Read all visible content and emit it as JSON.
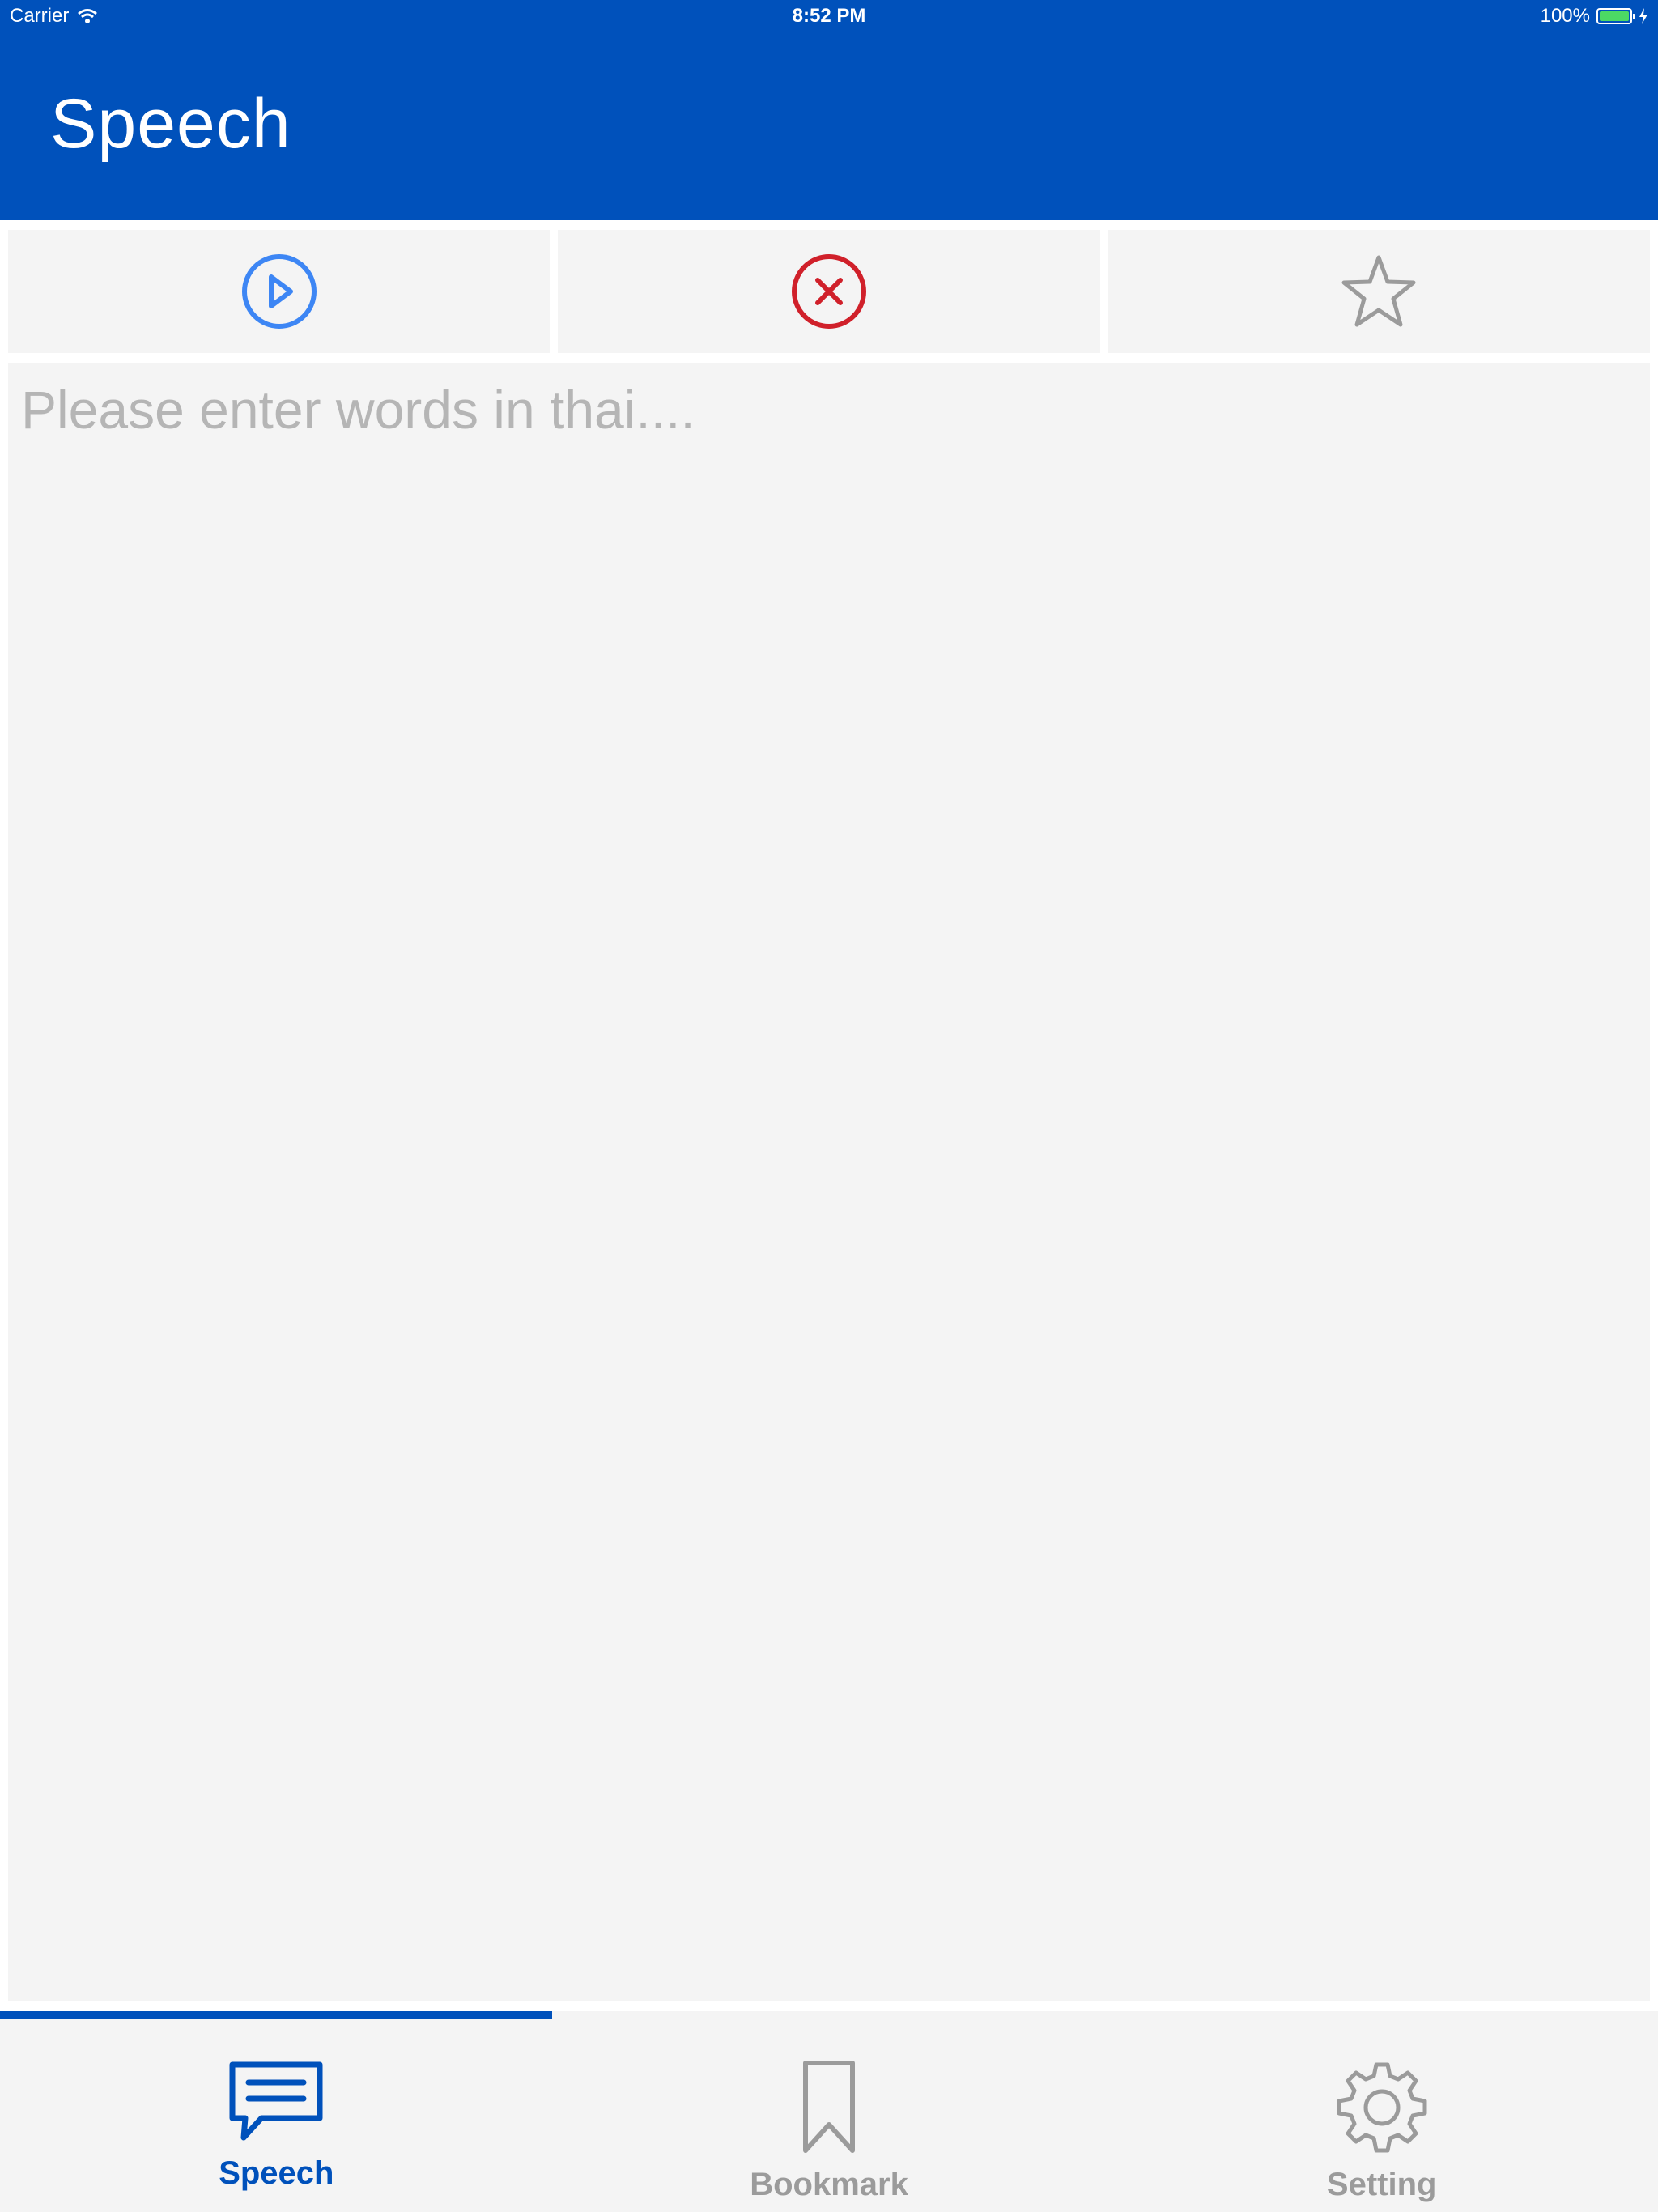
{
  "status_bar": {
    "carrier": "Carrier",
    "time": "8:52 PM",
    "battery": "100%",
    "battery_level": 1.0
  },
  "nav": {
    "title": "Speech"
  },
  "toolbar": {
    "play_icon": "play-circle-icon",
    "clear_icon": "close-circle-icon",
    "bookmark_icon": "star-outline-icon"
  },
  "editor": {
    "placeholder": "Please enter words in thai....",
    "value": ""
  },
  "tabs": [
    {
      "label": "Speech",
      "icon": "speech-bubble-icon",
      "active": true
    },
    {
      "label": "Bookmark",
      "icon": "bookmark-icon",
      "active": false
    },
    {
      "label": "Setting",
      "icon": "gear-icon",
      "active": false
    }
  ],
  "colors": {
    "primary": "#0051bb",
    "play": "#3d86f4",
    "clear": "#d0202a",
    "inactive": "#9b9b9b",
    "surface": "#f4f4f4",
    "placeholder": "#b5b5b5"
  }
}
